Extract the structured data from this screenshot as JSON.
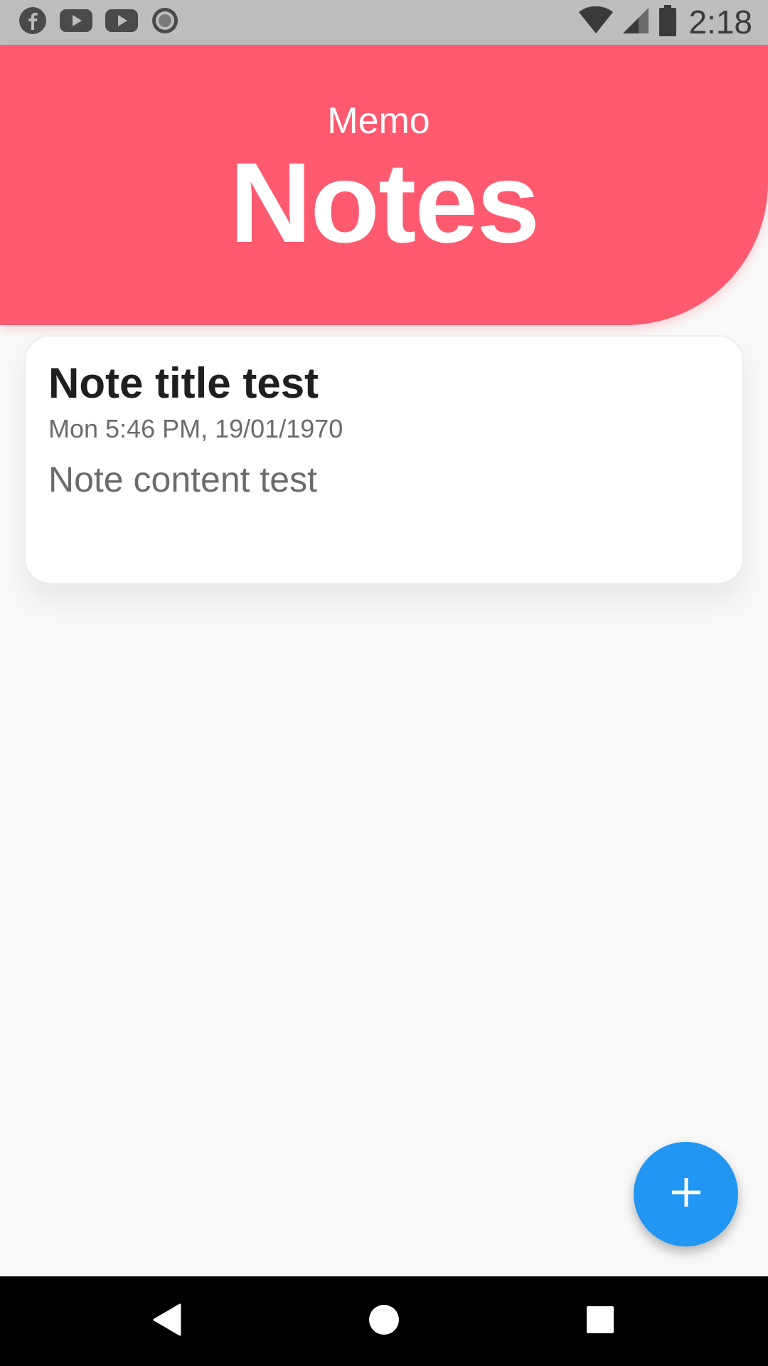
{
  "status_bar": {
    "time": "2:18",
    "left_icons": [
      "facebook-icon",
      "youtube-icon",
      "youtube-icon",
      "record-icon"
    ],
    "right_icons": [
      "wifi-icon",
      "cell-signal-icon",
      "battery-icon"
    ]
  },
  "header": {
    "subtitle": "Memo",
    "title": "Notes",
    "color": "#fe5a6f"
  },
  "notes": [
    {
      "title": "Note title test",
      "date": "Mon 5:46 PM, 19/01/1970",
      "content": "Note content test"
    }
  ],
  "fab": {
    "icon": "plus-icon",
    "color": "#2196f3"
  },
  "nav_bar": {
    "buttons": [
      "back-icon",
      "home-icon",
      "recents-icon"
    ]
  }
}
